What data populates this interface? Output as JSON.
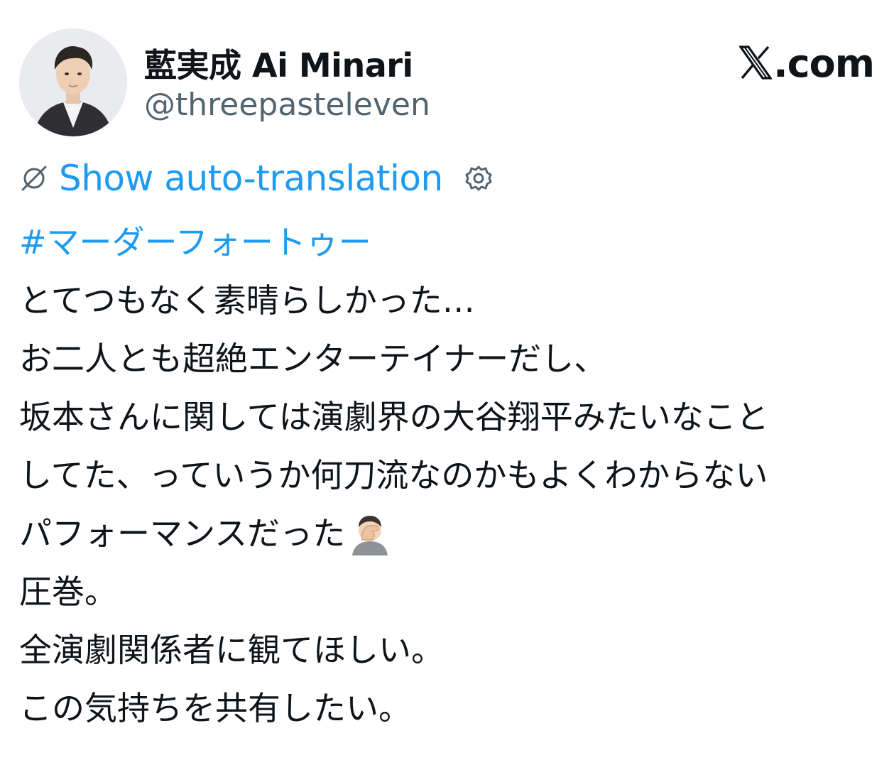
{
  "author": {
    "display_name": "藍実成 Ai Minari",
    "handle": "@threepasteleven",
    "avatar": "avatar-photo"
  },
  "site": {
    "logo_text": ".com",
    "logo_icon": "x-logo-icon"
  },
  "translation": {
    "label": "Show auto-translation",
    "icon": "globe-slash-icon",
    "settings_icon": "gear-icon"
  },
  "tweet": {
    "hashtag": "#マーダーフォートゥー",
    "lines": [
      "とてつもなく素晴らしかった…",
      "お二人とも超絶エンターテイナーだし、",
      "坂本さんに関しては演劇界の大谷翔平みたいなこと",
      "してた、っていうか何刀流なのかもよくわからない",
      "パフォーマンスだった",
      "圧巻。",
      "全演劇関係者に観てほしい。",
      "この気持ちを共有したい。"
    ],
    "emoji": "face-palm-emoji"
  },
  "colors": {
    "link": "#1d9bf0",
    "text": "#0f1419",
    "secondary": "#536471",
    "background": "#ffffff"
  }
}
